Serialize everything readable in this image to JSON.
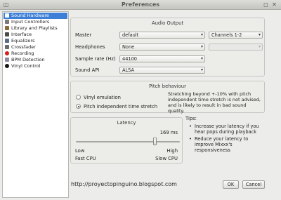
{
  "window": {
    "title": "Preferences"
  },
  "sidebar": {
    "items": [
      {
        "label": "Sound Hardware",
        "icon": "speaker-icon",
        "color": "#6c6c6c",
        "selected": true
      },
      {
        "label": "Input Controllers",
        "icon": "controller-icon",
        "color": "#7a7a7a"
      },
      {
        "label": "Library and Playlists",
        "icon": "library-icon",
        "color": "#8a6a3a"
      },
      {
        "label": "Interface",
        "icon": "monitor-icon",
        "color": "#4a4a4a"
      },
      {
        "label": "Equalizers",
        "icon": "equalizer-icon",
        "color": "#5a6a8a"
      },
      {
        "label": "Crossfader",
        "icon": "crossfader-icon",
        "color": "#6a6a6a"
      },
      {
        "label": "Recording",
        "icon": "record-icon",
        "color": "#d02020"
      },
      {
        "label": "BPM Detection",
        "icon": "bpm-icon",
        "color": "#8a8aa0"
      },
      {
        "label": "Vinyl Control",
        "icon": "vinyl-icon",
        "color": "#151515"
      }
    ]
  },
  "audio_output": {
    "title": "Audio Output",
    "master_label": "Master",
    "master_value": "default",
    "channels_value": "Channels 1-2",
    "headphones_label": "Headphones",
    "headphones_value": "None",
    "headphones_channels_value": "",
    "sample_rate_label": "Sample rate (Hz)",
    "sample_rate_value": "44100",
    "sound_api_label": "Sound API",
    "sound_api_value": "ALSA"
  },
  "pitch": {
    "title": "Pitch behaviour",
    "vinyl_label": "Vinyl emulation",
    "pitch_label": "Pitch independent time stretch",
    "note": "Stretching beyond +-10% with pitch independent time stretch is not advised, and is likely to result in bad sound quality."
  },
  "latency": {
    "title": "Latency",
    "value_text": "169 ms",
    "slider_fraction": 0.76,
    "low_label": "Low",
    "high_label": "High",
    "fast_label": "Fast CPU",
    "slow_label": "Slow CPU"
  },
  "tips": {
    "title": "Tips:",
    "items": [
      "Increase your latency if you hear pops during playback",
      "Reduce your latency to improve Mixxx's responsiveness"
    ]
  },
  "watermark": "http://proyectopinguino.blogspot.com",
  "buttons": {
    "ok_label": "OK",
    "cancel_label": "Cancel"
  }
}
